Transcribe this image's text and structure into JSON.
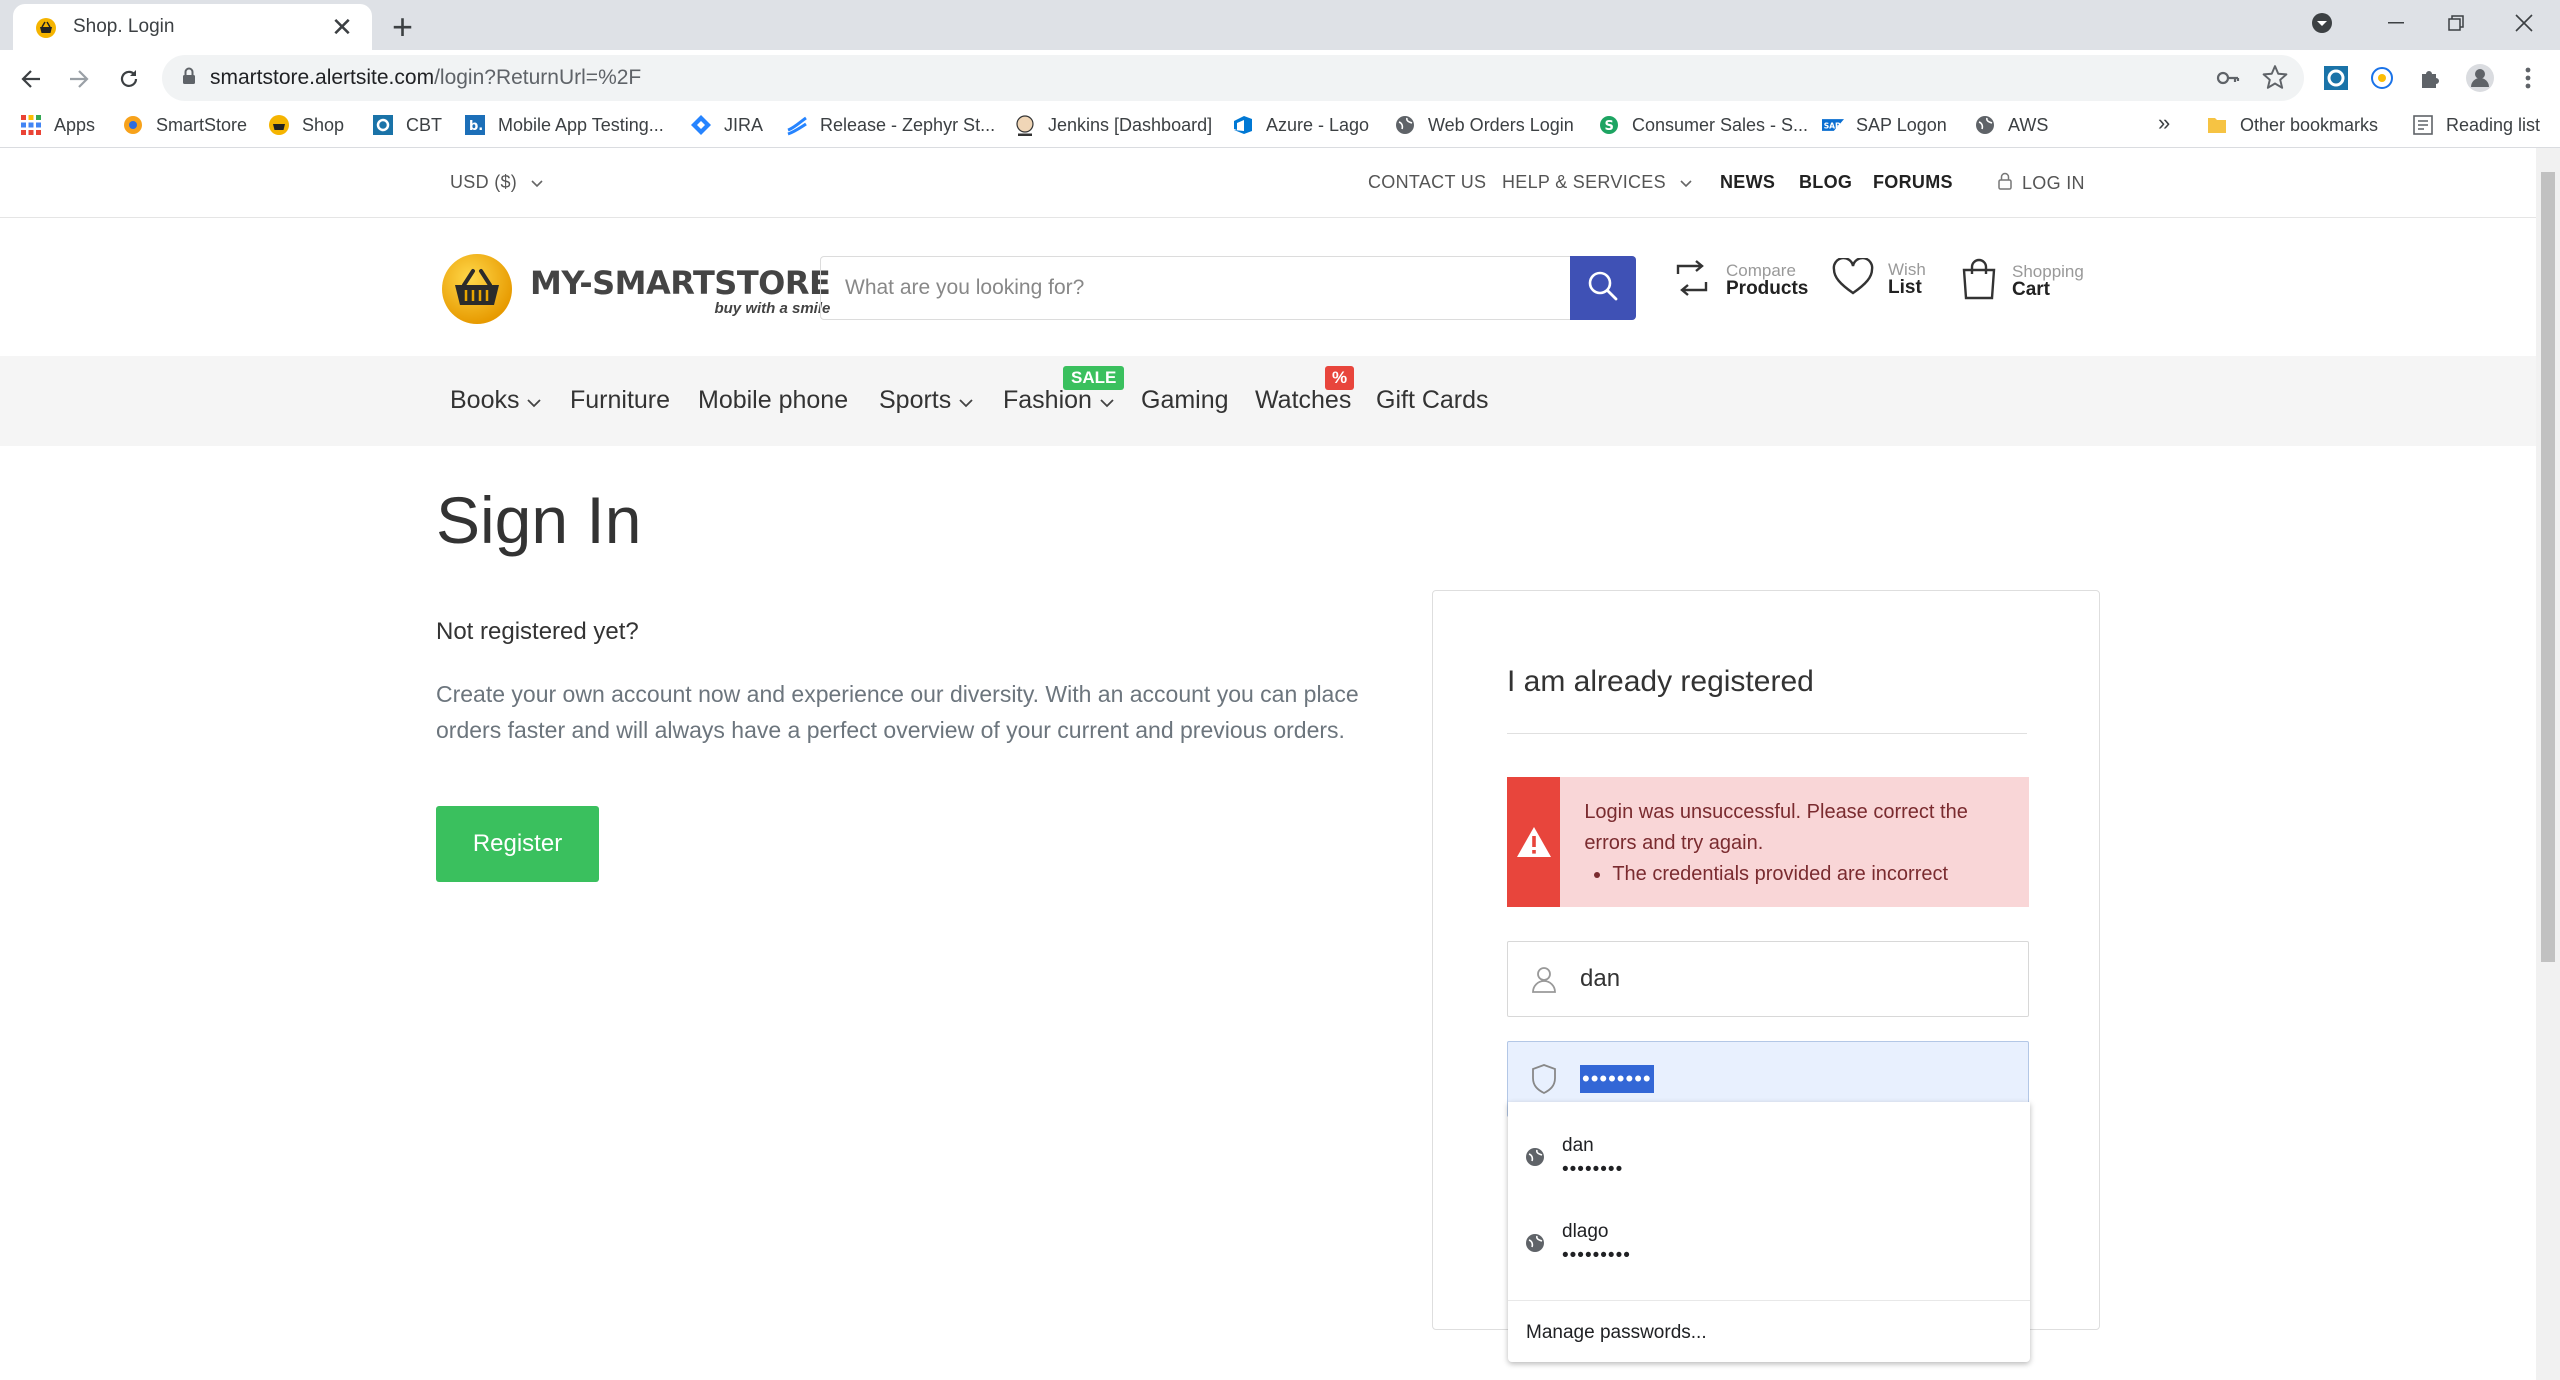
{
  "browser": {
    "tab_title": "Shop. Login",
    "url_host": "smartstore.alertsite.com",
    "url_path": "/login?ReturnUrl=%2F",
    "bookmarks": [
      {
        "label": "Apps"
      },
      {
        "label": "SmartStore"
      },
      {
        "label": "Shop"
      },
      {
        "label": "CBT"
      },
      {
        "label": "Mobile App Testing..."
      },
      {
        "label": "JIRA"
      },
      {
        "label": "Release - Zephyr St..."
      },
      {
        "label": "Jenkins [Dashboard]"
      },
      {
        "label": "Azure - Lago"
      },
      {
        "label": "Web Orders Login"
      },
      {
        "label": "Consumer Sales - S..."
      },
      {
        "label": "SAP Logon"
      },
      {
        "label": "AWS"
      }
    ],
    "more_bookmarks": "»",
    "other_bookmarks": "Other bookmarks",
    "reading_list": "Reading list"
  },
  "topbar": {
    "currency": "USD ($)",
    "contact": "CONTACT US",
    "help": "HELP & SERVICES",
    "news": "NEWS",
    "blog": "BLOG",
    "forums": "FORUMS",
    "login": "LOG IN"
  },
  "header": {
    "brand": "MY-SMARTSTORE",
    "tagline": "buy with a smile",
    "search_placeholder": "What are you looking for?",
    "compare_small": "Compare",
    "compare_big": "Products",
    "wish_small": "Wish",
    "wish_big": "List",
    "cart_small": "Shopping",
    "cart_big": "Cart"
  },
  "nav": {
    "items": [
      "Books",
      "Furniture",
      "Mobile phone",
      "Sports",
      "Fashion",
      "Gaming",
      "Watches",
      "Gift Cards"
    ],
    "sale_badge": "SALE",
    "percent_badge": "%"
  },
  "main": {
    "title": "Sign In",
    "not_registered": "Not registered yet?",
    "description": "Create your own account now and experience our diversity. With an account you can place orders faster and will always have a perfect overview of your current and previous orders.",
    "register_label": "Register"
  },
  "login": {
    "heading": "I am already registered",
    "error_text": "Login was unsuccessful. Please correct the errors and try again.",
    "error_item": "The credentials provided are incorrect",
    "username_value": "dan",
    "password_mask": "••••••••"
  },
  "autocomplete": {
    "entries": [
      {
        "user": "dan",
        "pass": "••••••••"
      },
      {
        "user": "dlago",
        "pass": "•••••••••"
      }
    ],
    "manage": "Manage passwords..."
  },
  "colors": {
    "search_button": "#3f51b5",
    "register_button": "#3ac05e",
    "alert_bg": "#f9d6d7",
    "alert_icon_bg": "#e8453c",
    "sale_badge": "#3ac05e",
    "percent_badge": "#e8453c"
  }
}
